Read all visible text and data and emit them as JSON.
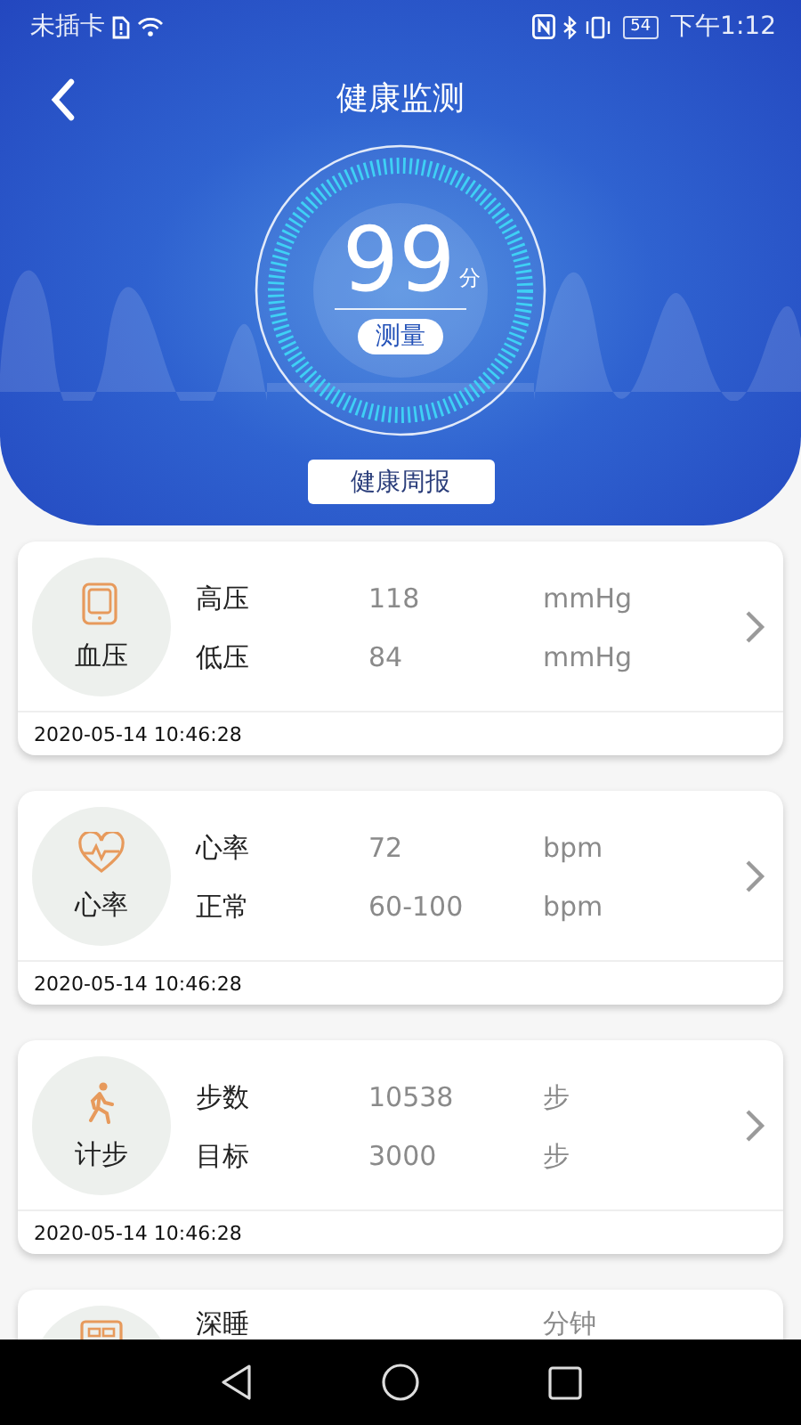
{
  "status_bar": {
    "carrier": "未插卡",
    "battery": "54",
    "time": "下午1:12"
  },
  "header": {
    "title": "健康监测",
    "score": "99",
    "score_unit": "分",
    "measure_button": "测量",
    "report_button": "健康周报"
  },
  "cards": [
    {
      "kind": "blood-pressure",
      "name": "血压",
      "rows": [
        {
          "label": "高压",
          "value": "118",
          "unit": "mmHg"
        },
        {
          "label": "低压",
          "value": "84",
          "unit": "mmHg"
        }
      ],
      "timestamp": "2020-05-14 10:46:28"
    },
    {
      "kind": "heart-rate",
      "name": "心率",
      "rows": [
        {
          "label": "心率",
          "value": "72",
          "unit": "bpm"
        },
        {
          "label": "正常",
          "value": "60-100",
          "unit": "bpm"
        }
      ],
      "timestamp": "2020-05-14 10:46:28"
    },
    {
      "kind": "steps",
      "name": "计步",
      "rows": [
        {
          "label": "步数",
          "value": "10538",
          "unit": "步"
        },
        {
          "label": "目标",
          "value": "3000",
          "unit": "步"
        }
      ],
      "timestamp": "2020-05-14 10:46:28"
    },
    {
      "kind": "sleep",
      "rows": [
        {
          "label": "深睡",
          "unit": "分钟"
        }
      ]
    }
  ]
}
